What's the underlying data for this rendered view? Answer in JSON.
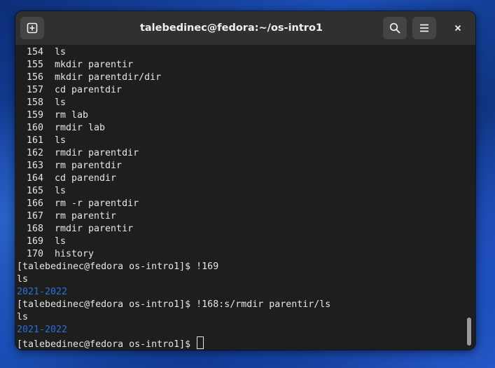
{
  "window": {
    "title": "talebedinec@fedora:~/os-intro1"
  },
  "icons": {
    "new_tab": "new-tab-icon",
    "search": "search-icon",
    "menu": "hamburger-menu-icon",
    "close": "close-icon"
  },
  "history": [
    {
      "num": "154",
      "cmd": "ls"
    },
    {
      "num": "155",
      "cmd": "mkdir parentir"
    },
    {
      "num": "156",
      "cmd": "mkdir parentdir/dir"
    },
    {
      "num": "157",
      "cmd": "cd parentdir"
    },
    {
      "num": "158",
      "cmd": "ls"
    },
    {
      "num": "159",
      "cmd": "rm lab"
    },
    {
      "num": "160",
      "cmd": "rmdir lab"
    },
    {
      "num": "161",
      "cmd": "ls"
    },
    {
      "num": "162",
      "cmd": "rmdir parentdir"
    },
    {
      "num": "163",
      "cmd": "rm parentdir"
    },
    {
      "num": "164",
      "cmd": "cd parendir"
    },
    {
      "num": "165",
      "cmd": "ls"
    },
    {
      "num": "166",
      "cmd": "rm -r parentdir"
    },
    {
      "num": "167",
      "cmd": "rm parentir"
    },
    {
      "num": "168",
      "cmd": "rmdir parentir"
    },
    {
      "num": "169",
      "cmd": "ls"
    },
    {
      "num": "170",
      "cmd": "history"
    }
  ],
  "session": {
    "prompt1": "[talebedinec@fedora os-intro1]$ !169",
    "echo1": "ls",
    "out1": "2021-2022",
    "prompt2": "[talebedinec@fedora os-intro1]$ !168:s/rmdir parentir/ls",
    "echo2": "ls",
    "out2": "2021-2022",
    "prompt3": "[talebedinec@fedora os-intro1]$ "
  },
  "colors": {
    "terminal_bg": "#1e1e1e",
    "terminal_fg": "#e6e6e6",
    "directory": "#2a6fd6",
    "titlebar": "#303030"
  }
}
